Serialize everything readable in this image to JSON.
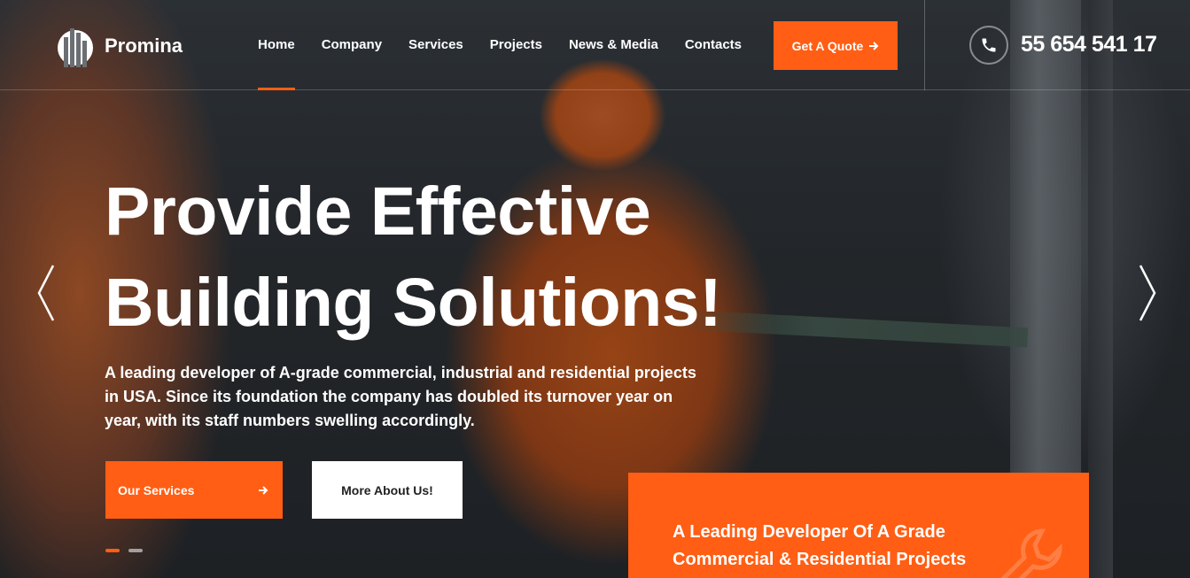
{
  "brand": {
    "name": "Promina",
    "accent_color": "#ff5e14"
  },
  "nav": {
    "items": [
      {
        "label": "Home",
        "active": true
      },
      {
        "label": "Company",
        "active": false
      },
      {
        "label": "Services",
        "active": false
      },
      {
        "label": "Projects",
        "active": false
      },
      {
        "label": "News & Media",
        "active": false
      },
      {
        "label": "Contacts",
        "active": false
      }
    ]
  },
  "header": {
    "quote_button": {
      "label": "Get A Quote",
      "icon": "arrow-right-icon"
    },
    "phone": {
      "icon": "phone-icon",
      "number": "55 654 541 17"
    }
  },
  "hero": {
    "headline_line1": "Provide Effective",
    "headline_line2": "Building Solutions!",
    "description": "A leading developer of A-grade commercial, industrial and residential projects in USA. Since its foundation the company has doubled its turnover year on year, with its staff numbers swelling accordingly.",
    "primary_button": {
      "label": "Our Services",
      "icon": "arrow-right-icon"
    },
    "secondary_button": {
      "label": "More About Us!"
    },
    "slider": {
      "total_slides": 2,
      "active_slide": 1,
      "prev_icon": "chevron-left-icon",
      "next_icon": "chevron-right-icon"
    }
  },
  "promo": {
    "line1": "A Leading Developer Of A Grade",
    "line2": "Commercial & Residential Projects",
    "icon": "wrench-icon"
  }
}
